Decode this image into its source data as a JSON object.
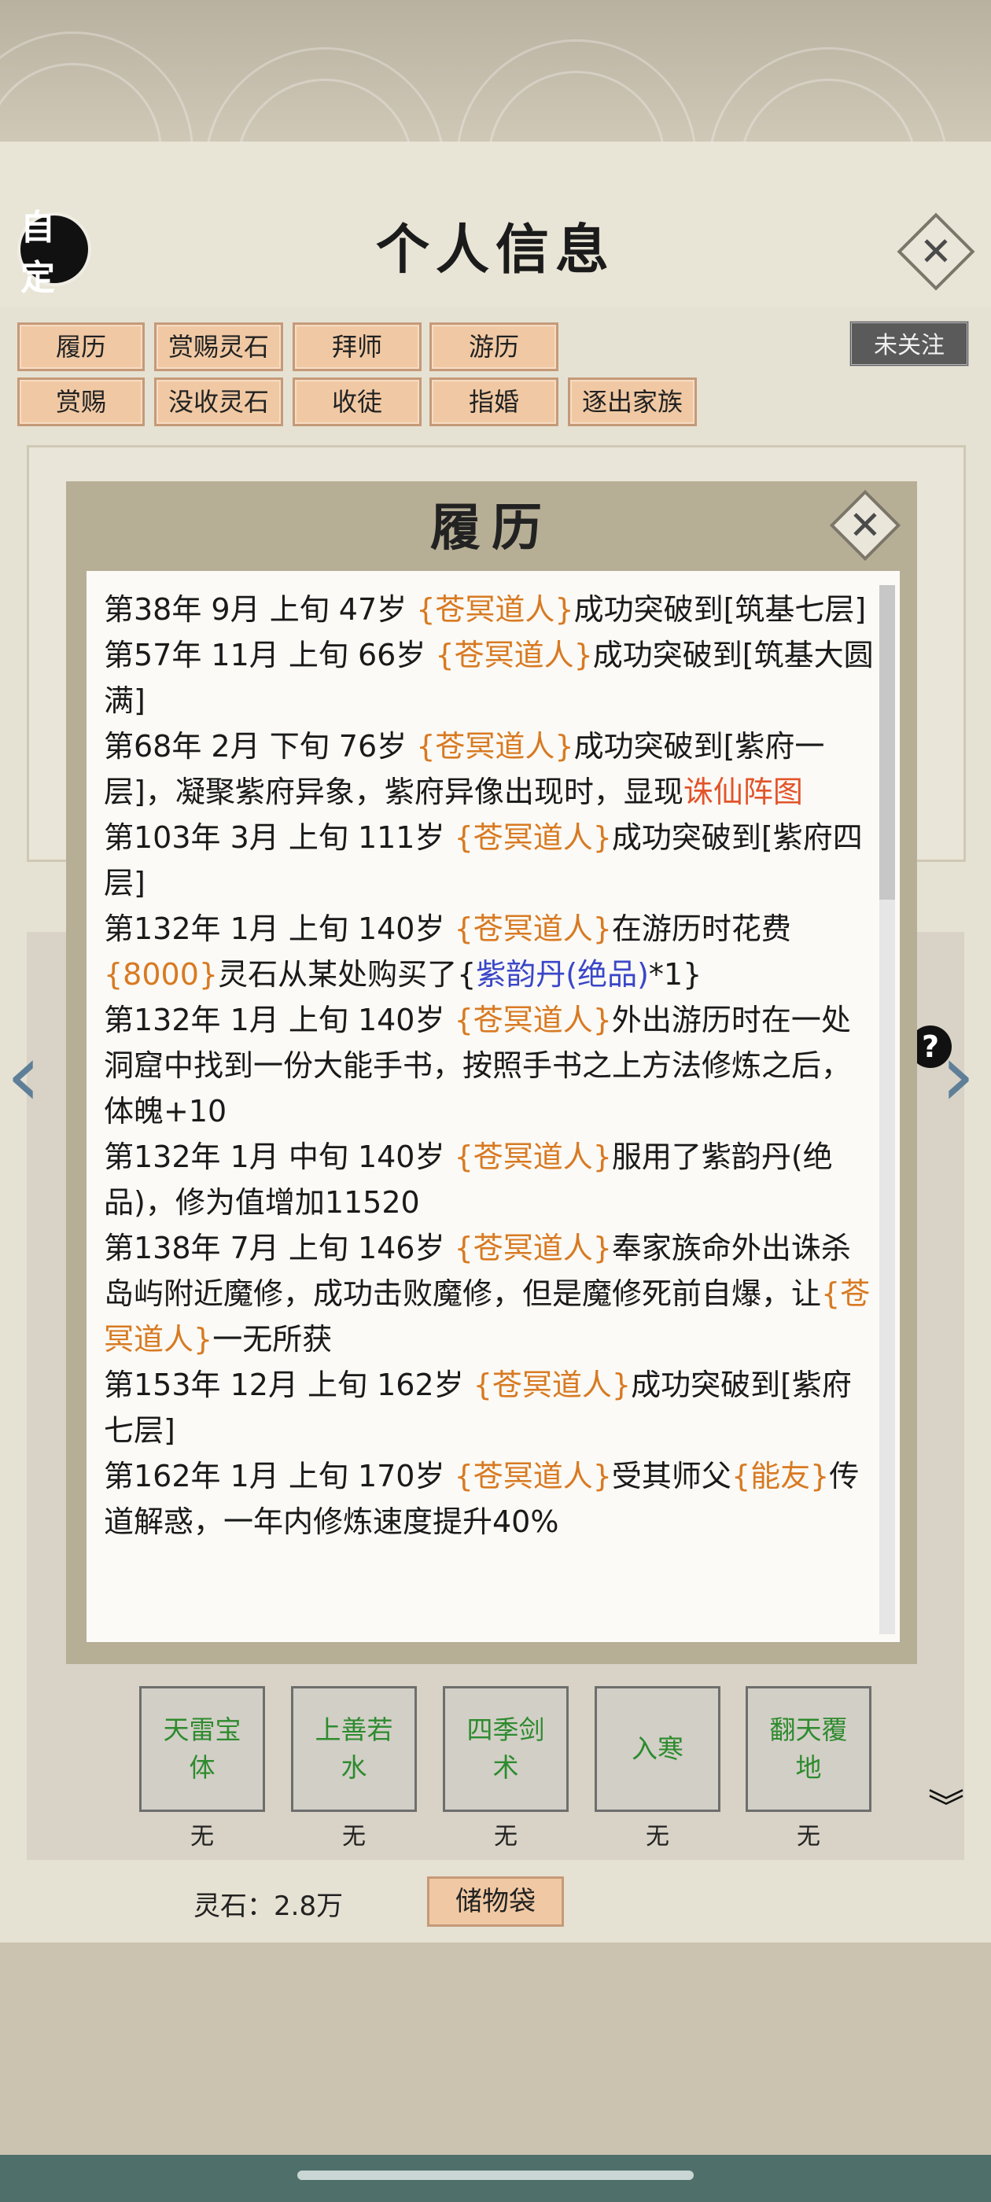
{
  "header": {
    "avatar_label": "自定",
    "title": "个人信息",
    "close_glyph": "✕"
  },
  "actions": {
    "row1": [
      "履历",
      "赏赐灵石",
      "拜师",
      "游历"
    ],
    "row2": [
      "赏赐",
      "没收灵石",
      "收徒",
      "指婚",
      "逐出家族"
    ],
    "follow": "未关注"
  },
  "modal": {
    "title": "履历",
    "close_glyph": "✕",
    "log": [
      [
        {
          "t": "第38年 9月 上旬  47岁 "
        },
        {
          "t": "{苍冥道人}",
          "c": "o"
        },
        {
          "t": "成功突破到[筑基七层]"
        }
      ],
      [
        {
          "t": "第57年 11月 上旬  66岁 "
        },
        {
          "t": "{苍冥道人}",
          "c": "o"
        },
        {
          "t": "成功突破到[筑基大圆满]"
        }
      ],
      [
        {
          "t": "第68年 2月 下旬  76岁 "
        },
        {
          "t": "{苍冥道人}",
          "c": "o"
        },
        {
          "t": "成功突破到[紫府一层]，凝聚紫府异象，紫府异像出现时，显现"
        },
        {
          "t": "诛仙阵图",
          "c": "r"
        }
      ],
      [
        {
          "t": "第103年 3月 上旬  111岁 "
        },
        {
          "t": "{苍冥道人}",
          "c": "o"
        },
        {
          "t": "成功突破到[紫府四层]"
        }
      ],
      [
        {
          "t": "第132年  1月  上旬   140岁   "
        },
        {
          "t": "{苍冥道人}",
          "c": "o"
        },
        {
          "t": "在游历时花费"
        },
        {
          "t": "{8000}",
          "c": "o"
        },
        {
          "t": "灵石从某处购买了{"
        },
        {
          "t": "紫韵丹(绝品)",
          "c": "b"
        },
        {
          "t": "*1}"
        }
      ],
      [
        {
          "t": "第132年 1月 上旬  140岁 "
        },
        {
          "t": "{苍冥道人}",
          "c": "o"
        },
        {
          "t": "外出游历时在一处洞窟中找到一份大能手书，按照手书之上方法修炼之后，体魄+10"
        }
      ],
      [
        {
          "t": "第132年 1月 中旬  140岁 "
        },
        {
          "t": "{苍冥道人}",
          "c": "o"
        },
        {
          "t": "服用了紫韵丹(绝品)，修为值增加11520"
        }
      ],
      [
        {
          "t": "第138年 7月 上旬  146岁 "
        },
        {
          "t": "{苍冥道人}",
          "c": "o"
        },
        {
          "t": "奉家族命外出诛杀岛屿附近魔修，成功击败魔修，但是魔修死前自爆，让"
        },
        {
          "t": "{苍冥道人}",
          "c": "o"
        },
        {
          "t": "一无所获"
        }
      ],
      [
        {
          "t": "第153年 12月 上旬  162岁 "
        },
        {
          "t": "{苍冥道人}",
          "c": "o"
        },
        {
          "t": "成功突破到[紫府七层]"
        }
      ],
      [
        {
          "t": "第162年 1月 上旬  170岁 "
        },
        {
          "t": "{苍冥道人}",
          "c": "o"
        },
        {
          "t": "受其师父"
        },
        {
          "t": "{能友}",
          "c": "o"
        },
        {
          "t": "传道解惑，一年内修炼速度提升40%"
        }
      ]
    ]
  },
  "skills": [
    {
      "name": "天雷宝体",
      "value": "无"
    },
    {
      "name": "上善若水",
      "value": "无"
    },
    {
      "name": "四季剑术",
      "value": "无"
    },
    {
      "name": "入寒",
      "value": "无"
    },
    {
      "name": "翻天覆地",
      "value": "无"
    }
  ],
  "footer": {
    "spirit_stone": "灵石：2.8万",
    "storage": "储物袋"
  },
  "icons": {
    "help": "?",
    "left_arrow": "‹",
    "right_arrow": "›",
    "scroll_down": "︾"
  },
  "colors": {
    "name_orange": "#d87a22",
    "highlight_red": "#e2542a",
    "item_blue": "#3a46c8",
    "skill_green": "#2e8b2e",
    "button_tan": "#f0c9a4"
  }
}
